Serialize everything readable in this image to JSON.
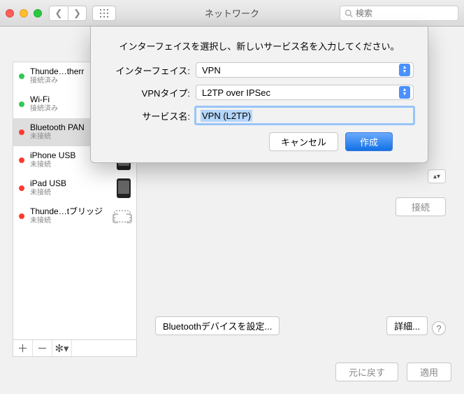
{
  "titlebar": {
    "title": "ネットワーク",
    "search_placeholder": "検索"
  },
  "sidebar": {
    "items": [
      {
        "dot": "green",
        "name": "Thunde…therr",
        "status": "接続済み",
        "icon": "none"
      },
      {
        "dot": "green",
        "name": "Wi-Fi",
        "status": "接続済み",
        "icon": "none"
      },
      {
        "dot": "red",
        "name": "Bluetooth PAN",
        "status": "未接続",
        "icon": "none",
        "selected": true
      },
      {
        "dot": "red",
        "name": "iPhone USB",
        "status": "未接続",
        "icon": "phone"
      },
      {
        "dot": "red",
        "name": "iPad USB",
        "status": "未接続",
        "icon": "phone"
      },
      {
        "dot": "red",
        "name": "Thunde…tブリッジ",
        "status": "未接続",
        "icon": "bridge"
      }
    ],
    "footer": {
      "add": "＋",
      "remove": "－",
      "gear": "✻▾"
    }
  },
  "main": {
    "connect_label": "接続",
    "setup_label": "Bluetoothデバイスを設定...",
    "detail_label": "詳細...",
    "help_label": "?"
  },
  "footer": {
    "revert_label": "元に戻す",
    "apply_label": "適用"
  },
  "sheet": {
    "instruction": "インターフェイスを選択し、新しいサービス名を入力してください。",
    "interface_label": "インターフェイス:",
    "interface_value": "VPN",
    "vpntype_label": "VPNタイプ:",
    "vpntype_value": "L2TP over IPSec",
    "service_label": "サービス名:",
    "service_value": "VPN (L2TP)",
    "cancel_label": "キャンセル",
    "create_label": "作成"
  }
}
